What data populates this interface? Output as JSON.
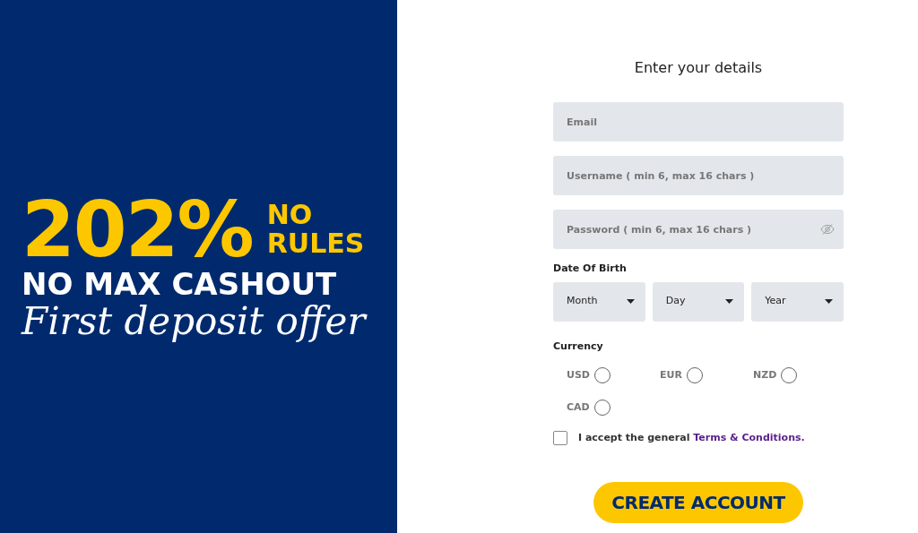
{
  "promo": {
    "percent": "202%",
    "side_top": "NO",
    "side_bottom": "RULES",
    "headline": "NO MAX CASHOUT",
    "tagline": "First deposit offer"
  },
  "form": {
    "title": "Enter your details",
    "fields": [
      {
        "placeholder": "Email",
        "kind": "text"
      },
      {
        "placeholder": "Username ( min 6, max 16 chars )",
        "kind": "text"
      },
      {
        "placeholder": "Password ( min 6, max 16 chars )",
        "kind": "password"
      }
    ],
    "dob_label": "Date Of Birth",
    "dob": [
      {
        "label": "Month"
      },
      {
        "label": "Day"
      },
      {
        "label": "Year"
      }
    ],
    "currency_label": "Currency",
    "currencies": [
      {
        "label": "USD",
        "selected": false
      },
      {
        "label": "EUR",
        "selected": false
      },
      {
        "label": "NZD",
        "selected": false
      },
      {
        "label": "CAD",
        "selected": false
      }
    ],
    "terms": {
      "text": "I accept the general",
      "link": "Terms & Conditions.",
      "checked": false
    },
    "submit": "CREATE ACCOUNT"
  }
}
